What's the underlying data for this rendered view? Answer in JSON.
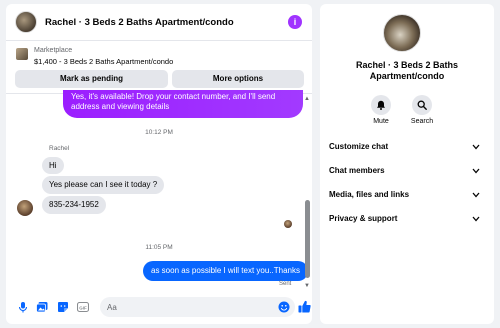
{
  "header": {
    "title": "Rachel · 3 Beds 2 Baths Apartment/condo",
    "info_icon": "info-icon",
    "accent": "#a033ff"
  },
  "marketplace": {
    "label": "Marketplace",
    "item": "$1,400 - 3 Beds 2 Baths Apartment/condo",
    "mark_pending_label": "Mark as pending",
    "more_options_label": "More options"
  },
  "messages": {
    "outgoing_top": "Yes, it's available! Drop your contact number, and I'll send address and viewing details",
    "time_1": "10:12 PM",
    "sender": "Rachel",
    "incoming": [
      "Hi",
      "Yes please can I see it today ?",
      "835-234-1952"
    ],
    "time_2": "11:05 PM",
    "outgoing_last": "as soon as possible I will text you..Thanks",
    "status": "Sent"
  },
  "composer": {
    "placeholder": "Aa"
  },
  "info_panel": {
    "title": "Rachel · 3 Beds 2 Baths Apartment/condo",
    "actions": {
      "mute": "Mute",
      "search": "Search"
    },
    "sections": [
      "Customize chat",
      "Chat members",
      "Media, files and links",
      "Privacy & support"
    ]
  },
  "colors": {
    "primary": "#0866ff",
    "bubble_in": "#e4e6eb",
    "purple": "#a033ff"
  }
}
